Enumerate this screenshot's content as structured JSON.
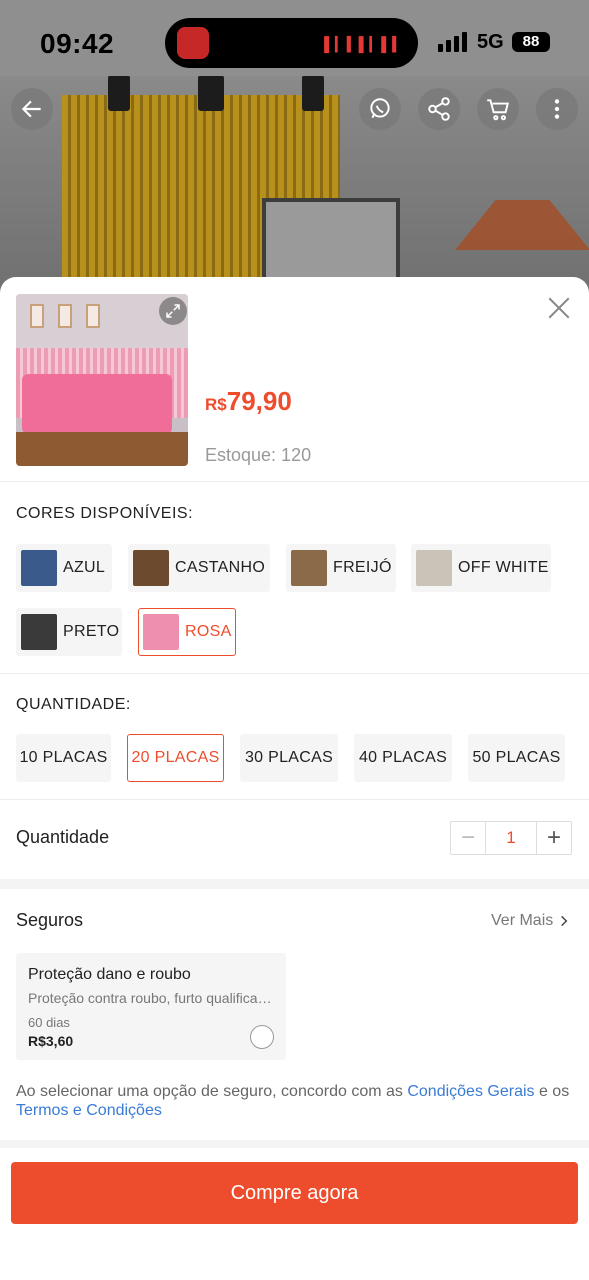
{
  "status_bar": {
    "time": "09:42",
    "network": "5G",
    "battery": "88"
  },
  "header": {
    "icons": [
      "back-arrow-icon",
      "whatsapp-icon",
      "share-icon",
      "cart-icon",
      "more-icon"
    ]
  },
  "product": {
    "price_currency": "R$",
    "price_value": "79,90",
    "stock": "Estoque: 120"
  },
  "colors": {
    "title": "CORES DISPONÍVEIS:",
    "options": [
      {
        "label": "AZUL",
        "selected": false,
        "swatch": "#3a5a8c"
      },
      {
        "label": "CASTANHO",
        "selected": false,
        "swatch": "#6b4a2e"
      },
      {
        "label": "FREIJÓ",
        "selected": false,
        "swatch": "#8a6a48"
      },
      {
        "label": "OFF WHITE",
        "selected": false,
        "swatch": "#c9c3b8"
      },
      {
        "label": "PRETO",
        "selected": false,
        "swatch": "#3a3a3a"
      },
      {
        "label": "ROSA",
        "selected": true,
        "swatch": "#ef8fb0"
      }
    ]
  },
  "quantity_options": {
    "title": "QUANTIDADE:",
    "options": [
      {
        "label": "10 PLACAS",
        "selected": false
      },
      {
        "label": "20 PLACAS",
        "selected": true
      },
      {
        "label": "30 PLACAS",
        "selected": false
      },
      {
        "label": "40 PLACAS",
        "selected": false
      },
      {
        "label": "50 PLACAS",
        "selected": false
      }
    ]
  },
  "quantity": {
    "label": "Quantidade",
    "value": "1",
    "minus": "−",
    "plus": "+"
  },
  "insurance": {
    "title": "Seguros",
    "see_more": "Ver Mais",
    "card": {
      "title": "Proteção dano e roubo",
      "description": "Proteção contra roubo, furto qualificado e danos acidentais",
      "duration": "60 dias",
      "price": "R$3,60"
    },
    "terms_prefix": "Ao selecionar uma opção de seguro, concordo com as ",
    "terms_link1": "Condições Gerais",
    "terms_middle": " e os ",
    "terms_link2": "Termos e Condições"
  },
  "buy_button": "Compre agora",
  "theme": {
    "accent": "#ee4d2d",
    "link": "#3a7bd5"
  }
}
